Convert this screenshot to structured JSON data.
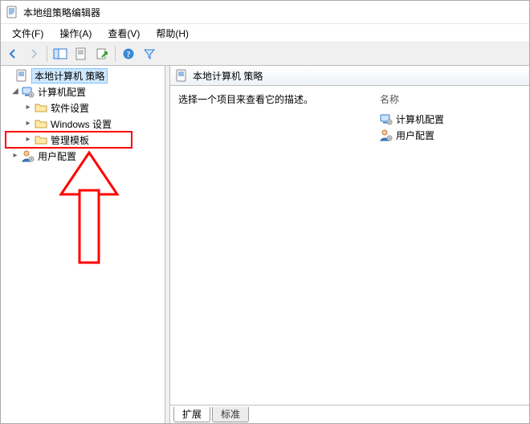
{
  "window": {
    "title": "本地组策略编辑器"
  },
  "menu": {
    "file": "文件(F)",
    "action": "操作(A)",
    "view": "查看(V)",
    "help": "帮助(H)"
  },
  "tree": {
    "root": {
      "label": "本地计算机 策略"
    },
    "computer_config": {
      "label": "计算机配置"
    },
    "software_settings": {
      "label": "软件设置"
    },
    "windows_settings": {
      "label": "Windows 设置"
    },
    "admin_templates": {
      "label": "管理模板"
    },
    "user_config": {
      "label": "用户配置"
    }
  },
  "content": {
    "title": "本地计算机 策略",
    "prompt": "选择一个项目来查看它的描述。",
    "column_name": "名称",
    "items": {
      "computer": "计算机配置",
      "user": "用户配置"
    }
  },
  "tabs": {
    "extended": "扩展",
    "standard": "标准"
  }
}
